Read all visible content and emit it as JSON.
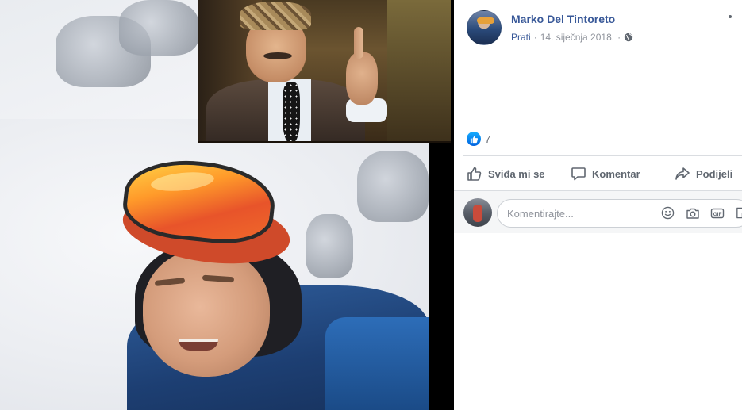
{
  "post": {
    "author": "Marko Del Tintoreto",
    "follow_label": "Prati",
    "separator": "·",
    "date": "14. siječnja 2018.",
    "audience_icon": "globe-icon"
  },
  "reactions": {
    "icon": "like-icon",
    "count": "7"
  },
  "actions": {
    "like_label": "Sviđa mi se",
    "comment_label": "Komentar",
    "share_label": "Podijeli"
  },
  "comment_box": {
    "placeholder": "Komentirajte...",
    "icons": [
      "emoji-icon",
      "camera-icon",
      "gif-icon",
      "sticker-icon"
    ]
  },
  "colors": {
    "link": "#385898",
    "muted": "#90949c",
    "action_text": "#606770",
    "like_blue": "#0062df"
  }
}
